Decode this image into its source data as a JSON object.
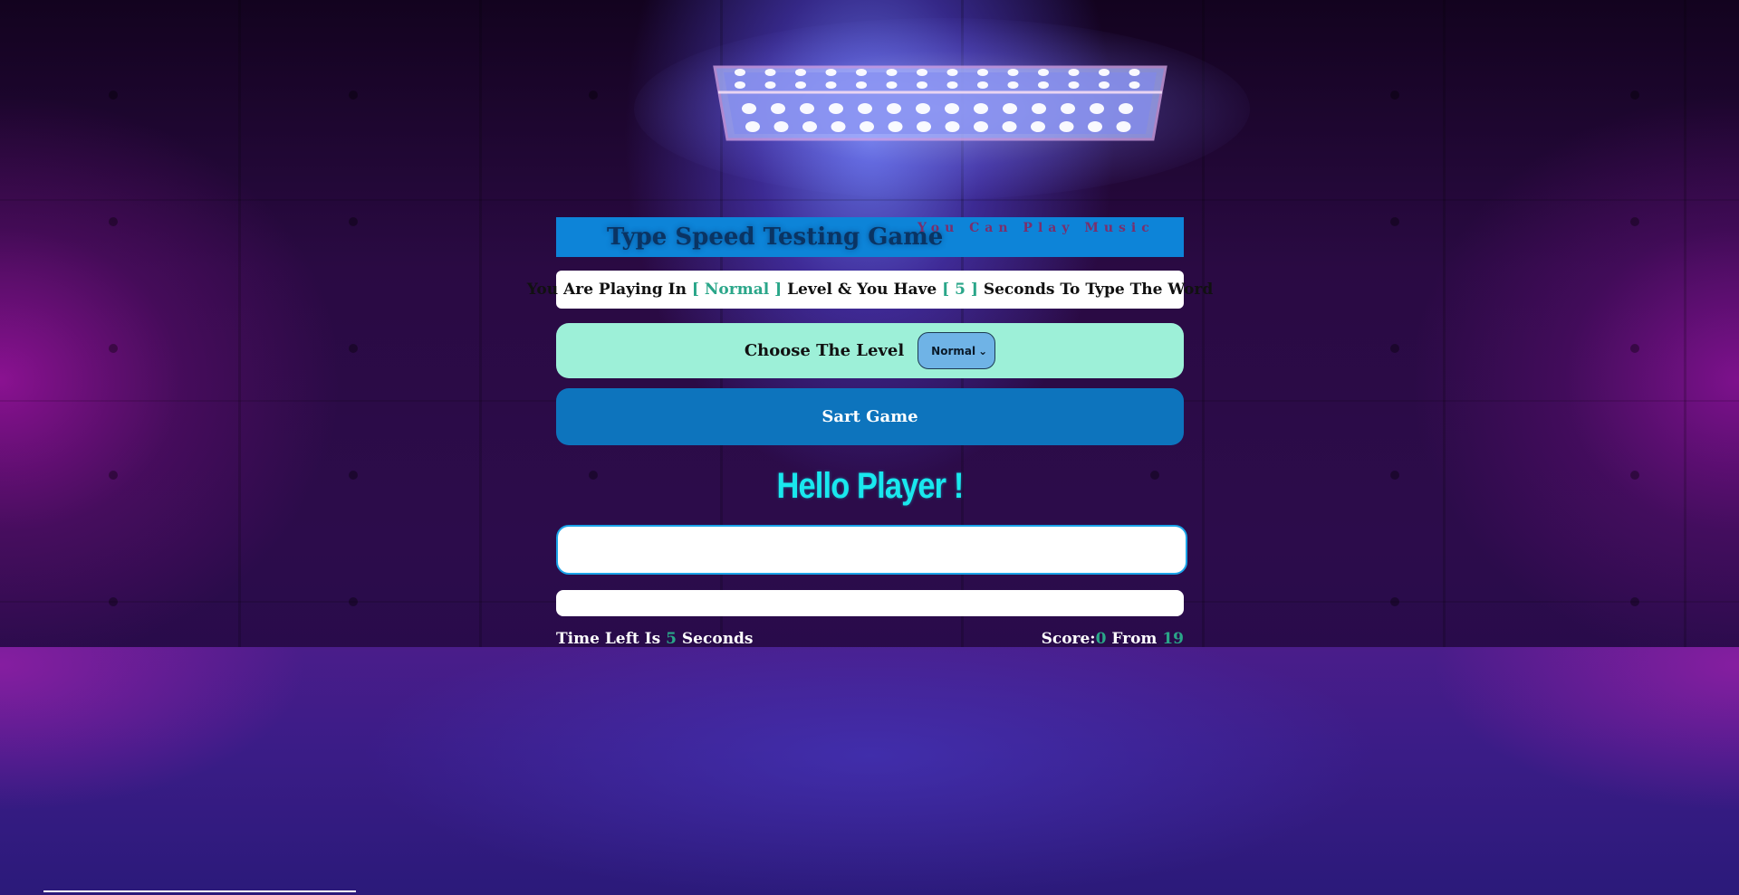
{
  "header": {
    "title": "Type Speed Testing Game",
    "music_hint": "You Can Play Music"
  },
  "message": {
    "prefix": "You Are Playing In",
    "level": "[ Normal ]",
    "middle": "Level & You Have",
    "seconds": "[ 5 ]",
    "suffix": "Seconds To Type The Word"
  },
  "level_chooser": {
    "label": "Choose The Level",
    "selected": "Normal"
  },
  "start_button": {
    "label": "Sart Game"
  },
  "greeting": "Hello Player !",
  "input": {
    "value": "",
    "placeholder": ""
  },
  "stats": {
    "time_prefix": "Time Left Is",
    "time_value": "5",
    "time_suffix": "Seconds",
    "score_prefix": "Score:",
    "score_value": "0",
    "score_middle": "From",
    "score_total": "19"
  },
  "colors": {
    "header_bar": "#0d84d8",
    "accent": "#2aa689",
    "level_box": "#9df0d8",
    "start_button": "#0d74bd",
    "greeting": "#19e8ee"
  }
}
